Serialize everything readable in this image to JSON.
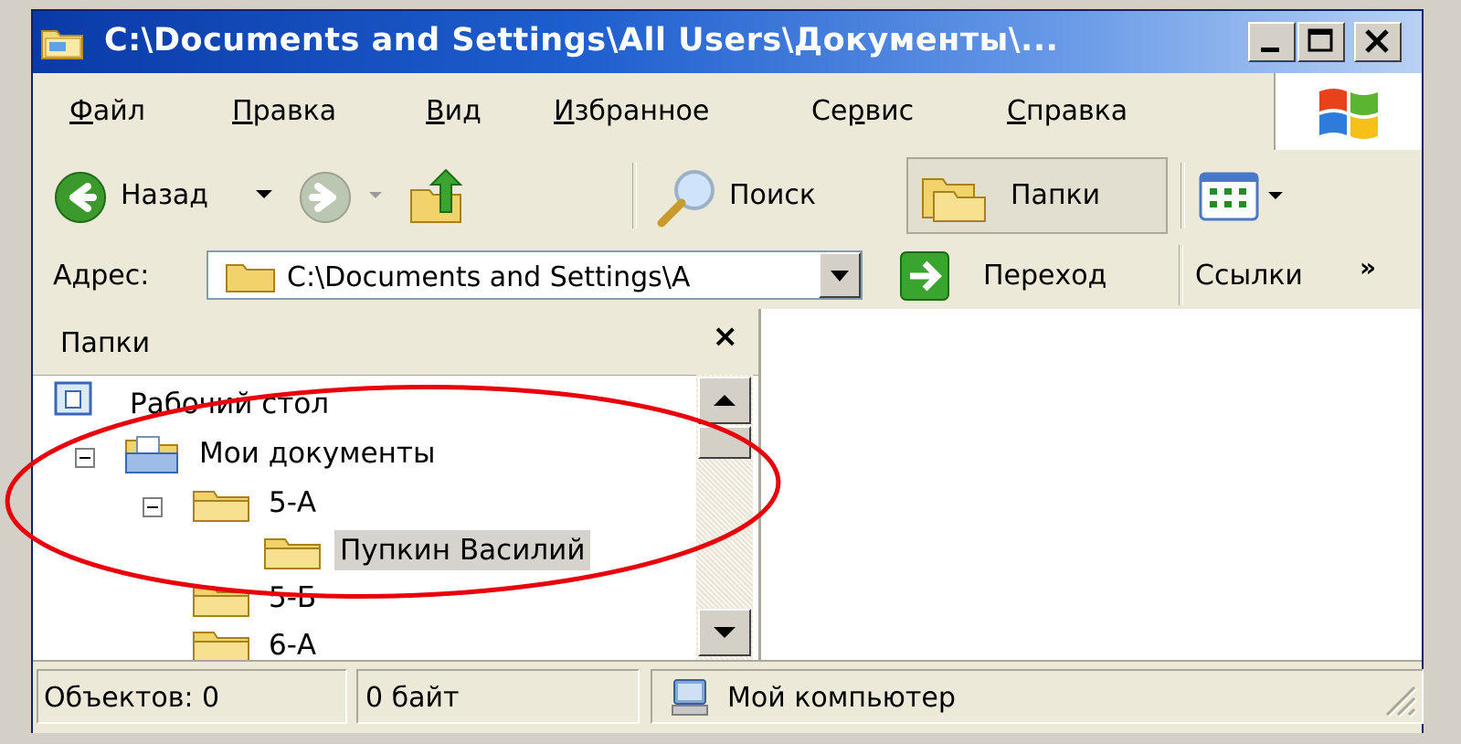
{
  "window": {
    "title": "C:\\Documents and Settings\\All Users\\Документы\\...",
    "icon": "folder-window-icon"
  },
  "menu": {
    "items": [
      {
        "label": "Файл",
        "accel_index": 0
      },
      {
        "label": "Правка",
        "accel_index": 0
      },
      {
        "label": "Вид",
        "accel_index": 0
      },
      {
        "label": "Избранное",
        "accel_index": 0
      },
      {
        "label": "Сервис",
        "accel_index": 2
      },
      {
        "label": "Справка",
        "accel_index": 0
      }
    ]
  },
  "toolbar": {
    "back_label": "Назад",
    "search_label": "Поиск",
    "folders_label": "Папки"
  },
  "address": {
    "label": "Адрес:",
    "value": "C:\\Documents and Settings\\A",
    "go_label": "Переход",
    "links_label": "Ссылки",
    "more": "»"
  },
  "folders_pane": {
    "title": "Папки",
    "close": "×",
    "tree": [
      {
        "label": "Рабочий стол",
        "icon": "desktop-icon"
      },
      {
        "label": "Мои документы",
        "icon": "my-documents-icon",
        "expanded": true
      },
      {
        "label": "5-А",
        "icon": "folder-icon",
        "expanded": true
      },
      {
        "label": "Пупкин Василий",
        "icon": "folder-icon",
        "selected": true
      },
      {
        "label": "5-Б",
        "icon": "folder-icon"
      },
      {
        "label": "6-А",
        "icon": "folder-icon"
      }
    ]
  },
  "status": {
    "objects": "Объектов: 0",
    "size": "0 байт",
    "location": "Мой компьютер"
  },
  "colors": {
    "title_bar": "#0a3aa8",
    "annotation": "#e8000b",
    "window_bg": "#ece9d8"
  }
}
